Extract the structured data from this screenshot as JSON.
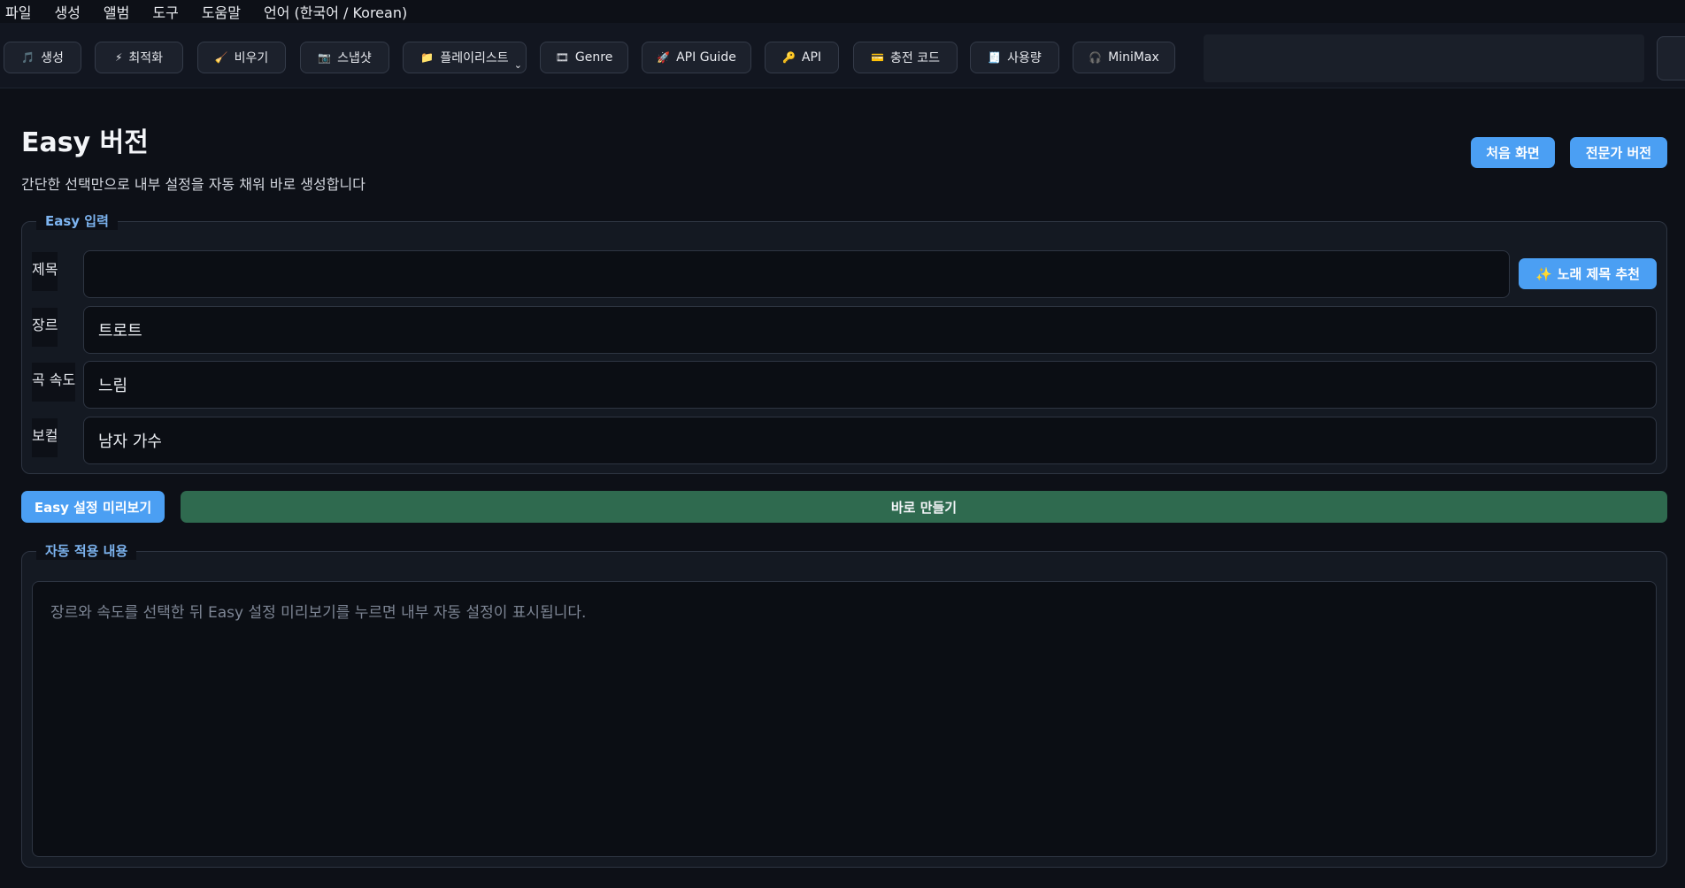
{
  "menu": [
    "파일",
    "생성",
    "앨범",
    "도구",
    "도움말",
    "언어 (한국어 / Korean)"
  ],
  "toolbar": [
    {
      "icon": "music-note-icon",
      "glyph": "🎵",
      "label": "생성"
    },
    {
      "icon": "lightning-icon",
      "glyph": "⚡",
      "label": "최적화"
    },
    {
      "icon": "broom-icon",
      "glyph": "🧹",
      "label": "비우기"
    },
    {
      "icon": "camera-icon",
      "glyph": "📷",
      "label": "스냅샷"
    },
    {
      "icon": "folder-icon",
      "glyph": "📁",
      "label": "플레이리스트"
    },
    {
      "icon": "picture-icon",
      "glyph": "🎞",
      "label": "Genre"
    },
    {
      "icon": "rocket-icon",
      "glyph": "🚀",
      "label": "API Guide"
    },
    {
      "icon": "key-icon",
      "glyph": "🔑",
      "label": "API"
    },
    {
      "icon": "card-icon",
      "glyph": "💳",
      "label": "충전 코드"
    },
    {
      "icon": "receipt-icon",
      "glyph": "🧾",
      "label": "사용량"
    },
    {
      "icon": "headphones-icon",
      "glyph": "🎧",
      "label": "MiniMax"
    }
  ],
  "header": {
    "title": "Easy 버전",
    "subtitle": "간단한 선택만으로 내부 설정을 자동 채워 바로 생성합니다",
    "home_button": "처음 화면",
    "expert_button": "전문가 버전"
  },
  "easy_input": {
    "legend": "Easy 입력",
    "title_label": "제목",
    "title_value": "",
    "recommend_button": "노래 제목 추천",
    "recommend_glyph": "✨",
    "genre_label": "장르",
    "genre_value": "트로트",
    "tempo_label": "곡 속도",
    "tempo_value": "느림",
    "vocal_label": "보컬",
    "vocal_value": "남자 가수"
  },
  "actions": {
    "preview_button": "Easy 설정 미리보기",
    "make_button": "바로 만들기"
  },
  "auto_applied": {
    "legend": "자동 적용 내용",
    "placeholder": "장르와 속도를 선택한 뒤 Easy 설정 미리보기를 누르면 내부 자동 설정이 표시됩니다."
  },
  "colors": {
    "accent": "#4b9ff3",
    "make": "#2f6a4f",
    "background": "#0d1017",
    "legend": "#7db4f0"
  }
}
